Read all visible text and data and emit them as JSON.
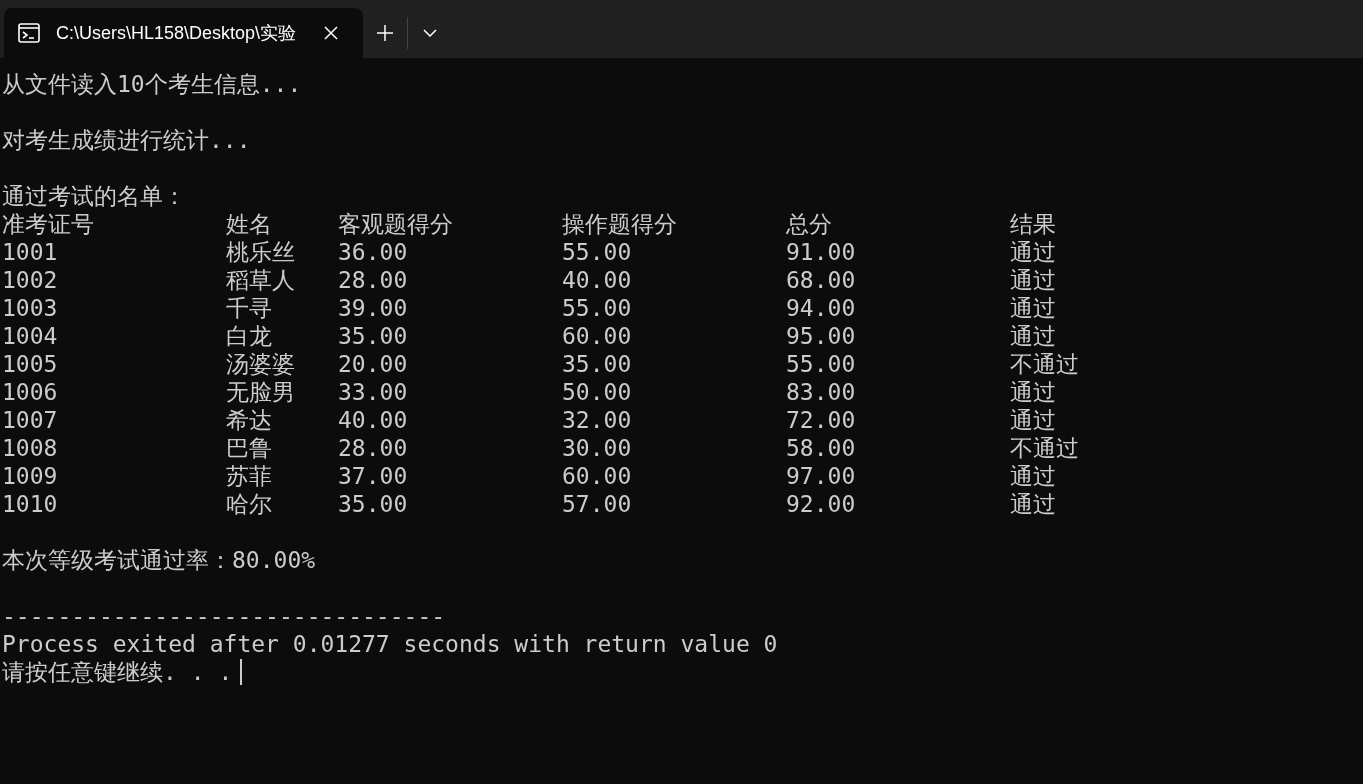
{
  "tabs": [
    {
      "title": "C:\\Users\\HL158\\Desktop\\实验",
      "selected": true
    }
  ],
  "console": {
    "messages": [
      "从文件读入10个考生信息...",
      "对考生成绩进行统计..."
    ],
    "list_title": "通过考试的名单：",
    "table": {
      "columns": [
        "准考证号",
        "姓名",
        "客观题得分",
        "操作题得分",
        "总分",
        "结果"
      ],
      "rows": [
        [
          "1001",
          "桃乐丝",
          "36.00",
          "55.00",
          "91.00",
          "通过"
        ],
        [
          "1002",
          "稻草人",
          "28.00",
          "40.00",
          "68.00",
          "通过"
        ],
        [
          "1003",
          "千寻",
          "39.00",
          "55.00",
          "94.00",
          "通过"
        ],
        [
          "1004",
          "白龙",
          "35.00",
          "60.00",
          "95.00",
          "通过"
        ],
        [
          "1005",
          "汤婆婆",
          "20.00",
          "35.00",
          "55.00",
          "不通过"
        ],
        [
          "1006",
          "无脸男",
          "33.00",
          "50.00",
          "83.00",
          "通过"
        ],
        [
          "1007",
          "希达",
          "40.00",
          "32.00",
          "72.00",
          "通过"
        ],
        [
          "1008",
          "巴鲁",
          "28.00",
          "30.00",
          "58.00",
          "不通过"
        ],
        [
          "1009",
          "苏菲",
          "37.00",
          "60.00",
          "97.00",
          "通过"
        ],
        [
          "1010",
          "哈尔",
          "35.00",
          "57.00",
          "92.00",
          "通过"
        ]
      ]
    },
    "pass_rate": "本次等级考试通过率：80.00%",
    "separator": "--------------------------------",
    "exit_message": "Process exited after 0.01277 seconds with return value 0",
    "prompt": "请按任意键继续. . ."
  }
}
